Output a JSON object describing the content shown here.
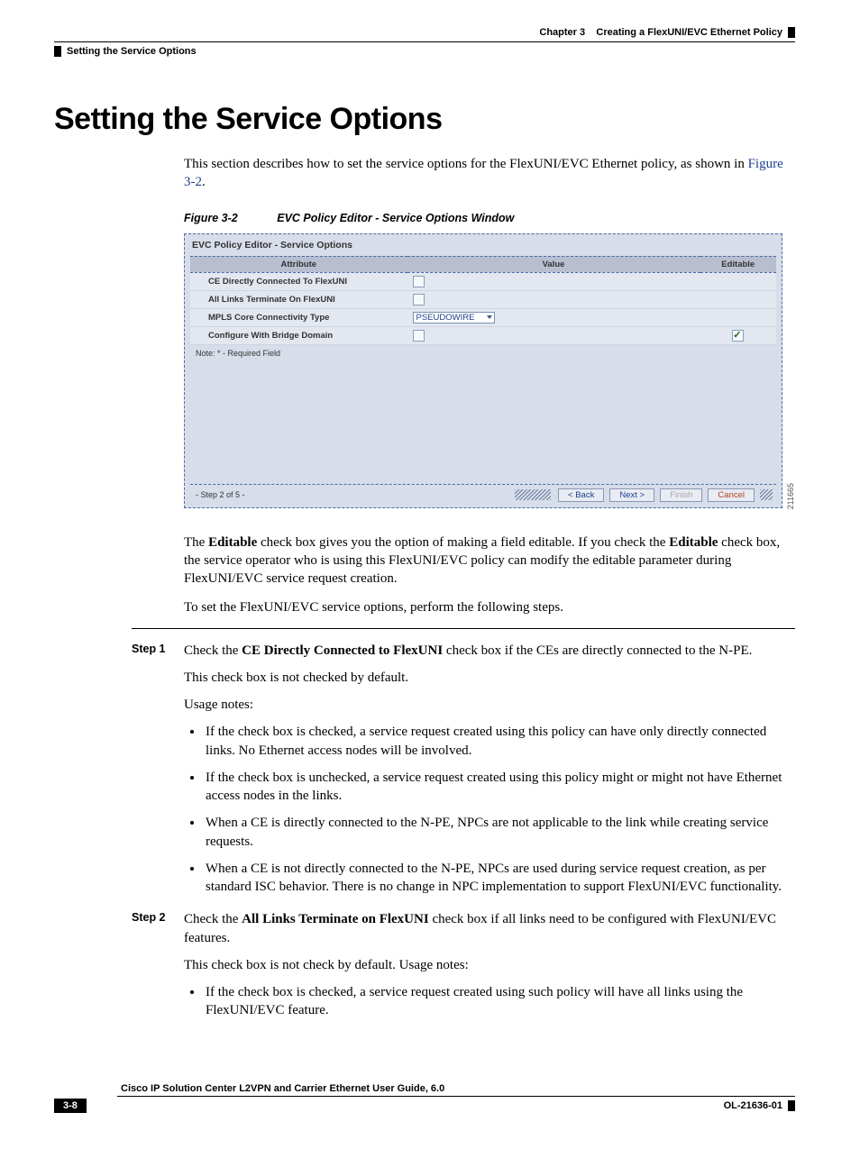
{
  "header": {
    "chapter_label": "Chapter 3",
    "chapter_title": "Creating a FlexUNI/EVC Ethernet Policy",
    "section_crumb": "Setting the Service Options"
  },
  "title": "Setting the Service Options",
  "intro": {
    "p1": "This section describes how to set the service options for the FlexUNI/EVC Ethernet policy, as shown in ",
    "figref": "Figure 3-2",
    "p1b": "."
  },
  "figure": {
    "label": "Figure 3-2",
    "caption": "EVC Policy Editor - Service Options Window",
    "code": "211665"
  },
  "screenshot": {
    "title": "EVC Policy Editor - Service Options",
    "columns": {
      "c1": "Attribute",
      "c2": "Value",
      "c3": "Editable"
    },
    "rows": {
      "r1": {
        "attr": "CE Directly Connected To FlexUNI"
      },
      "r2": {
        "attr": "All Links Terminate On FlexUNI"
      },
      "r3": {
        "attr": "MPLS Core Connectivity Type",
        "value": "PSEUDOWIRE"
      },
      "r4": {
        "attr": "Configure With Bridge Domain"
      }
    },
    "note": "Note: * - Required Field",
    "step": "- Step 2 of 5 -",
    "buttons": {
      "back": "< Back",
      "next": "Next >",
      "finish": "Finish",
      "cancel": "Cancel"
    }
  },
  "post_figure": {
    "p1a": "The ",
    "b1": "Editable",
    "p1b": " check box gives you the option of making a field editable. If you check the ",
    "b2": "Editable",
    "p1c": " check box, the service operator who is using this FlexUNI/EVC policy can modify the editable parameter during FlexUNI/EVC service request creation.",
    "p2": "To set the FlexUNI/EVC service options, perform the following steps."
  },
  "step1": {
    "label": "Step 1",
    "p1a": "Check the ",
    "b1": "CE Directly Connected to FlexUNI",
    "p1b": " check box if the CEs are directly connected to the N-PE.",
    "p2": "This check box is not checked by default.",
    "p3": "Usage notes:",
    "li1": "If the check box is checked, a service request created using this policy can have only directly connected links. No Ethernet access nodes will be involved.",
    "li2": "If the check box is unchecked, a service request created using this policy might or might not have Ethernet access nodes in the links.",
    "li3": "When a CE is directly connected to the N-PE, NPCs are not applicable to the link while creating service requests.",
    "li4": "When a CE is not directly connected to the N-PE, NPCs are used during service request creation, as per standard ISC behavior. There is no change in NPC implementation to support FlexUNI/EVC functionality."
  },
  "step2": {
    "label": "Step 2",
    "p1a": "Check the ",
    "b1": "All Links Terminate on FlexUNI",
    "p1b": " check box if all links need to be configured with FlexUNI/EVC features.",
    "p2": "This check box is not check by default. Usage notes:",
    "li1": "If the check box is checked, a service request created using such policy will have all links using the FlexUNI/EVC feature."
  },
  "footer": {
    "guide": "Cisco IP Solution Center L2VPN and Carrier Ethernet User Guide, 6.0",
    "pagenum": "3-8",
    "olcode": "OL-21636-01"
  }
}
